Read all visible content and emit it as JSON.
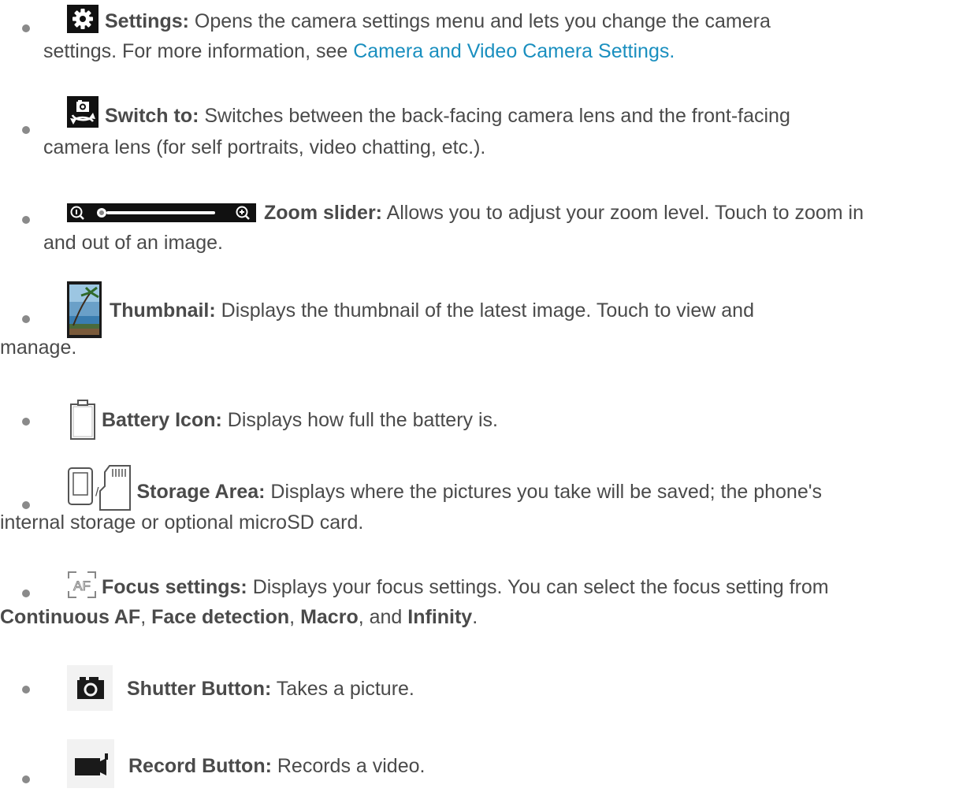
{
  "items": [
    {
      "icon": "gear-icon",
      "title": "Settings:",
      "text": " Opens the camera settings menu and lets you change the camera",
      "text2": "settings. For more information, see ",
      "link": "Camera and Video Camera Settings."
    },
    {
      "icon": "camera-switch-icon",
      "title": "Switch to:",
      "text": " Switches between the back-facing camera lens and the front-facing",
      "text2": "camera lens (for self portraits, video chatting, etc.)."
    },
    {
      "icon": "zoom-slider-icon",
      "title": "Zoom slider:",
      "text": " Allows you to adjust your zoom level. Touch to zoom in",
      "text2": "and out of an image."
    },
    {
      "icon": "thumbnail-image-icon",
      "title": "Thumbnail:",
      "text": " Displays the thumbnail of the latest image. Touch to view and",
      "text2": "manage."
    },
    {
      "icon": "battery-icon",
      "title": "Battery Icon:",
      "text": " Displays how full the battery is."
    },
    {
      "icon": "internal-storage-icon",
      "icon2": "microsd-card-icon",
      "separator": "/",
      "title": "Storage Area:",
      "text": " Displays where the pictures you take will be saved; the phone's",
      "text2": "internal storage or optional microSD card."
    },
    {
      "icon": "af-focus-icon",
      "title": "Focus settings:",
      "text": " Displays your focus settings. You can select the focus setting from",
      "opt1": "Continuous AF",
      "sep1": ", ",
      "opt2": "Face detection",
      "sep2": ", ",
      "opt3": "Macro",
      "sep3": ", and ",
      "opt4": "Infinity",
      "end": "."
    },
    {
      "icon": "camera-shutter-icon",
      "title": "Shutter Button:",
      "text": " Takes a picture."
    },
    {
      "icon": "video-camera-icon",
      "title": "Record Button:",
      "text": " Records a video."
    }
  ],
  "colors": {
    "text": "#4a4a4a",
    "link": "#1a8fbf",
    "bullet": "#8a8a8a"
  }
}
